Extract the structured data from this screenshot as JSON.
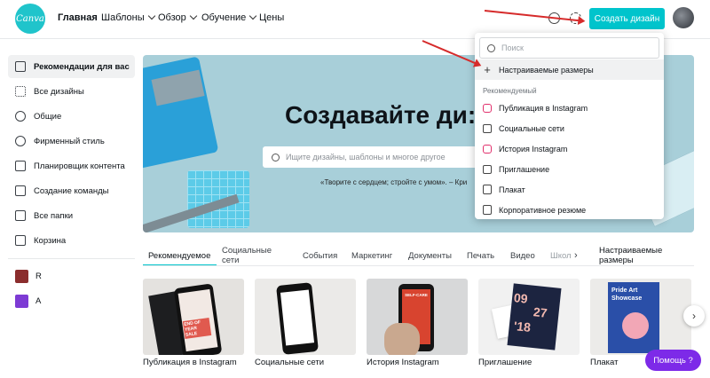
{
  "header": {
    "logo_text": "Canva",
    "nav": [
      {
        "label": "Главная",
        "active": true
      },
      {
        "label": "Шаблоны",
        "dropdown": true
      },
      {
        "label": "Обзор",
        "dropdown": true
      },
      {
        "label": "Обучение",
        "dropdown": true
      },
      {
        "label": "Цены",
        "dropdown": false
      }
    ],
    "create_button": "Создать дизайн"
  },
  "sidebar": {
    "items": [
      {
        "label": "Рекомендации для вас",
        "icon": "home-icon",
        "active": true
      },
      {
        "label": "Все дизайны",
        "icon": "grid-icon"
      },
      {
        "label": "Общие",
        "icon": "people-icon"
      },
      {
        "label": "Фирменный стиль",
        "icon": "brand-icon"
      },
      {
        "label": "Планировщик контента",
        "icon": "calendar-icon"
      },
      {
        "label": "Создание команды",
        "icon": "building-icon"
      },
      {
        "label": "Все папки",
        "icon": "folder-icon"
      },
      {
        "label": "Корзина",
        "icon": "trash-icon"
      }
    ],
    "teams": [
      {
        "label": "R",
        "color": "#8b2d2d"
      },
      {
        "label": "A",
        "color": "#7d3bd4"
      }
    ]
  },
  "hero": {
    "title": "Создавайте ди:",
    "search_placeholder": "Ищите дизайны, шаблоны и многое другое",
    "quote": "«Творите с сердцем; стройте с умом». – Кри"
  },
  "tabs": {
    "items": [
      "Рекомендуемое",
      "Социальные сети",
      "События",
      "Маркетинг",
      "Документы",
      "Печать",
      "Видео",
      "Школ"
    ],
    "custom_sizes": "Настраиваемые размеры"
  },
  "cards": [
    {
      "label": "Публикация в Instagram"
    },
    {
      "label": "Социальные сети"
    },
    {
      "label": "История Instagram"
    },
    {
      "label": "Приглашение",
      "art_text_1": "09",
      "art_text_2": "27",
      "art_text_3": "'18"
    },
    {
      "label": "Плакат",
      "art_text_1": "Pride Art",
      "art_text_2": "Showcase"
    }
  ],
  "card_art": {
    "instagram_post_text": "END OF YEAR SALE",
    "story_text": "SELF-CARE"
  },
  "dropdown": {
    "search_placeholder": "Поиск",
    "custom_sizes": "Настраиваемые размеры",
    "heading": "Рекомендуемый",
    "items": [
      {
        "label": "Публикация в Instagram",
        "icon": "instagram-icon"
      },
      {
        "label": "Социальные сети",
        "icon": "heart-icon"
      },
      {
        "label": "История Instagram",
        "icon": "instagram-icon"
      },
      {
        "label": "Приглашение",
        "icon": "envelope-icon"
      },
      {
        "label": "Плакат",
        "icon": "poster-icon"
      },
      {
        "label": "Корпоративное резюме",
        "icon": "document-icon"
      }
    ]
  },
  "help_button": "Помощь ?",
  "colors": {
    "accent": "#00c4cc",
    "help": "#7d2ae8",
    "annotation_arrow": "#d62b2b"
  }
}
